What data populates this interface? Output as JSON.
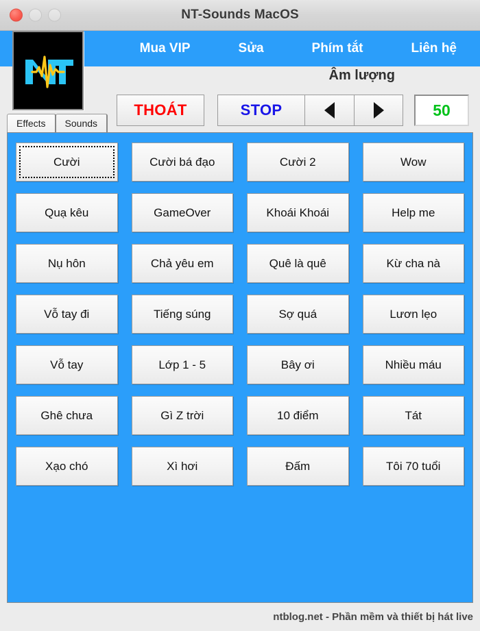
{
  "window": {
    "title": "NT-Sounds MacOS",
    "traffic_lights": [
      "close-button",
      "minimize-button",
      "maximize-button"
    ]
  },
  "nav": {
    "logo_alt": "NT logo",
    "items": [
      {
        "label": "Mua VIP"
      },
      {
        "label": "Sửa"
      },
      {
        "label": "Phím tắt"
      },
      {
        "label": "Liên hệ"
      }
    ]
  },
  "toolbar": {
    "quit_label": "THOÁT",
    "stop_label": "STOP",
    "volume_label": "Âm lượng",
    "volume_down_icon": "triangle-left-icon",
    "volume_up_icon": "triangle-right-icon",
    "volume_value": "50"
  },
  "tabs": [
    {
      "label": "Effects",
      "active": true
    },
    {
      "label": "Sounds",
      "active": false
    }
  ],
  "grid": {
    "focused_index": 0,
    "rows": [
      [
        "Cười",
        "Cười bá đạo",
        "Cười 2",
        "Wow"
      ],
      [
        "Quạ kêu",
        "GameOver",
        "Khoái Khoái",
        "Help me"
      ],
      [
        "Nụ hôn",
        "Chả yêu em",
        "Quê là quê",
        "Kừ cha nà"
      ],
      [
        "Vỗ tay đi",
        "Tiếng súng",
        "Sợ quá",
        "Lươn lẹo"
      ],
      [
        "Vỗ tay",
        "Lớp 1 - 5",
        "Bây ơi",
        "Nhiều máu"
      ],
      [
        "Ghê chưa",
        "Gì Z trời",
        "10 điểm",
        "Tát"
      ],
      [
        "Xạo chó",
        "Xì hơi",
        "Đấm",
        "Tôi 70 tuổi"
      ]
    ]
  },
  "footer": {
    "text": "ntblog.net - Phần mềm và thiết bị hát live"
  },
  "colors": {
    "accent_blue": "#2B9EFA",
    "quit_red": "#FF0000",
    "stop_blue": "#1A16E8",
    "volume_green": "#00C21A",
    "logo_cyan": "#2BC4F5",
    "logo_yellow": "#FFC819"
  }
}
